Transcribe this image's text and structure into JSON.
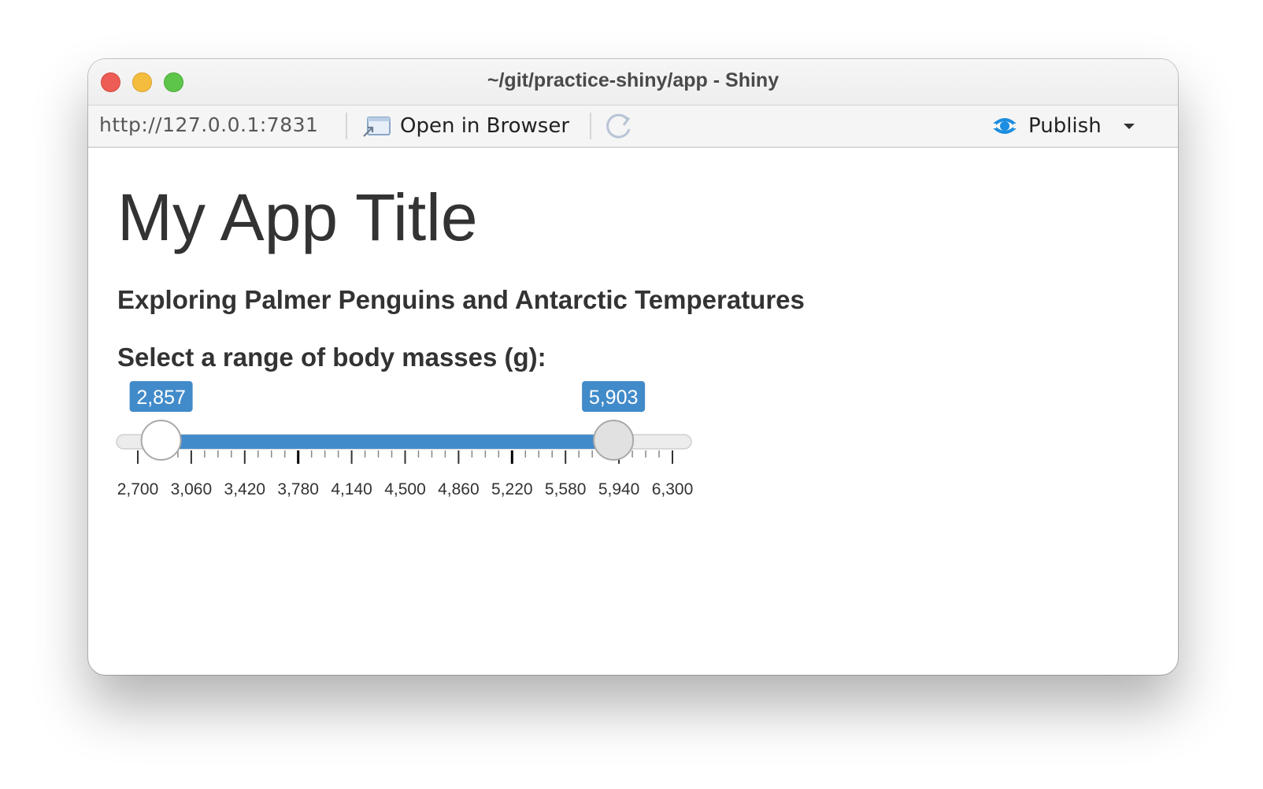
{
  "window": {
    "title": "~/git/practice-shiny/app - Shiny"
  },
  "toolbar": {
    "url": "http://127.0.0.1:7831",
    "open_in_browser": "Open in Browser",
    "publish": "Publish"
  },
  "app": {
    "title": "My App Title",
    "subtitle": "Exploring Palmer Penguins and Antarctic Temperatures"
  },
  "slider": {
    "label": "Select a range of body masses (g):",
    "min": 2700,
    "max": 6300,
    "low_value": 2857,
    "high_value": 5903,
    "low_label": "2,857",
    "high_label": "5,903",
    "tick_labels": [
      "2,700",
      "3,060",
      "3,420",
      "3,780",
      "4,140",
      "4,500",
      "4,860",
      "5,220",
      "5,580",
      "5,940",
      "6,300"
    ],
    "accent_color": "#428bca"
  }
}
